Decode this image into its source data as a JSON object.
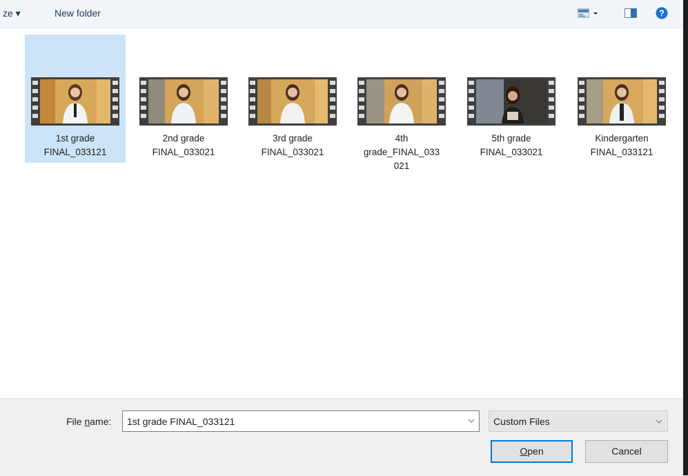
{
  "toolbar": {
    "organize_label": "ze ▾",
    "new_folder_label": "New folder",
    "icons": [
      "view-options-icon",
      "chevron-down-icon",
      "preview-pane-icon",
      "help-icon"
    ]
  },
  "files": [
    {
      "line1": "1st grade",
      "line2": "FINAL_033121",
      "line3": "",
      "selected": true
    },
    {
      "line1": "2nd grade",
      "line2": "FINAL_033021",
      "line3": "",
      "selected": false
    },
    {
      "line1": "3rd grade",
      "line2": "FINAL_033021",
      "line3": "",
      "selected": false
    },
    {
      "line1": "4th",
      "line2": "grade_FINAL_033",
      "line3": "021",
      "selected": false
    },
    {
      "line1": "5th grade",
      "line2": "FINAL_033021",
      "line3": "",
      "selected": false
    },
    {
      "line1": "Kindergarten",
      "line2": "FINAL_033121",
      "line3": "",
      "selected": false
    }
  ],
  "footer": {
    "file_name_label_pre": "File ",
    "file_name_label_key": "n",
    "file_name_label_post": "ame:",
    "file_name_value": "1st grade FINAL_033121",
    "file_type": "Custom Files",
    "open_label_key": "O",
    "open_label_rest": "pen",
    "cancel_label": "Cancel"
  },
  "colors": {
    "selection": "#cce4f7",
    "accent": "#0078d7",
    "toolbar_bg": "#f2f5f9",
    "footer_bg": "#f0f0f0"
  }
}
